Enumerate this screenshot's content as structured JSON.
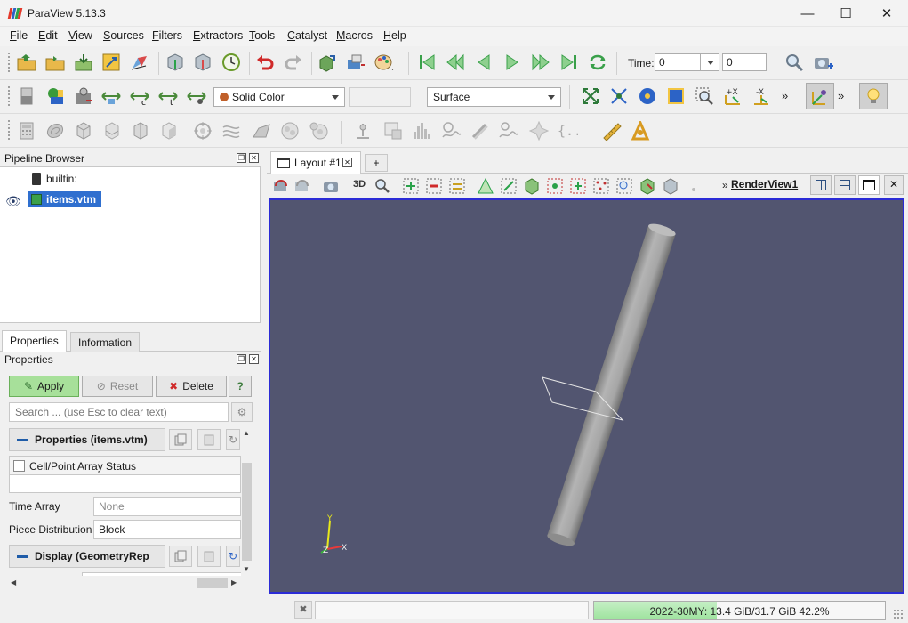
{
  "window": {
    "title": "ParaView 5.13.3",
    "controls": {
      "minimize": "—",
      "maximize": "☐",
      "close": "✕"
    },
    "logo_colors": [
      "#e4392b",
      "#2c63c6",
      "#2aa24a"
    ]
  },
  "menu": [
    {
      "underline": "F",
      "rest": "ile"
    },
    {
      "underline": "E",
      "rest": "dit"
    },
    {
      "underline": "V",
      "rest": "iew"
    },
    {
      "underline": "S",
      "rest": "ources"
    },
    {
      "underline": "F",
      "rest": "ilters"
    },
    {
      "underline": "E",
      "rest": "xtractors"
    },
    {
      "underline": "T",
      "rest": "ools"
    },
    {
      "underline": "C",
      "rest": "atalyst"
    },
    {
      "underline": "M",
      "rest": "acros"
    },
    {
      "underline": "H",
      "rest": "elp"
    }
  ],
  "toolbar_main": {
    "time_label": "Time:",
    "time_value": "0",
    "time_step_value": "0"
  },
  "toolbar_display": {
    "coloring": "Solid Color",
    "coloring_swatch": "#c0602a",
    "component": "",
    "representation": "Surface",
    "overflow": "»"
  },
  "pipeline": {
    "title": "Pipeline Browser",
    "items": [
      {
        "label": "builtin:",
        "selected": false
      },
      {
        "label": "items.vtm",
        "selected": true
      }
    ]
  },
  "properties": {
    "tabs": [
      "Properties",
      "Information"
    ],
    "title": "Properties",
    "apply": "Apply",
    "reset": "Reset",
    "delete": "Delete",
    "help": "?",
    "search_placeholder": "Search ... (use Esc to clear text)",
    "section_properties": "Properties (items.vtm)",
    "cell_point_status": "Cell/Point Array Status",
    "time_array_label": "Time Array",
    "time_array_value": "None",
    "piece_distribution_label": "Piece Distribution",
    "piece_distribution_value": "Block",
    "section_display": "Display (GeometryRep"
  },
  "layout": {
    "tab": "Layout #1",
    "add_tab": "+",
    "view_label": "3D",
    "render_view_name": "RenderView1",
    "background": "#525570"
  },
  "axes": {
    "x": "X",
    "y": "Y",
    "z": "Z"
  },
  "status": {
    "memory_text": "2022-30MY: 13.4 GiB/31.7 GiB 42.2%",
    "memory_fraction": 0.422
  }
}
